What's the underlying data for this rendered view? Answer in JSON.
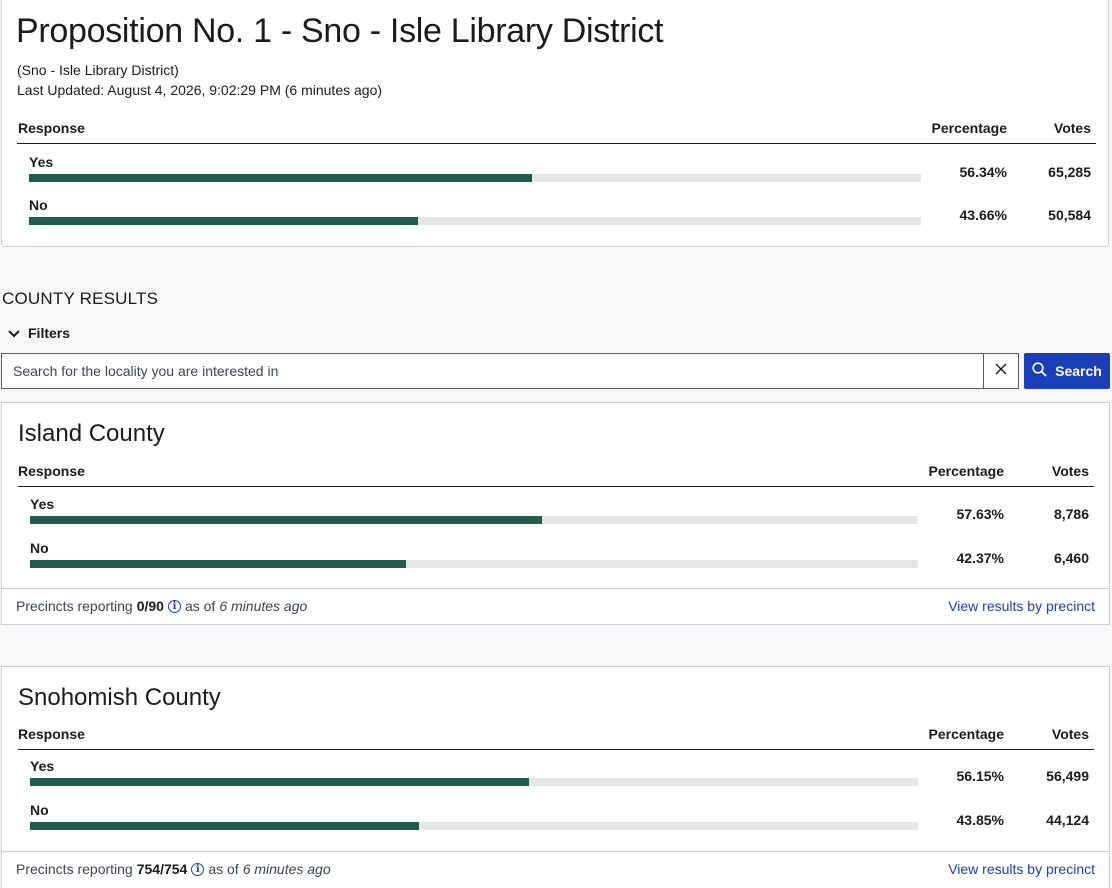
{
  "summary": {
    "title": "Proposition No. 1 - Sno - Isle Library District",
    "district": "(Sno - Isle Library District)",
    "last_updated": "Last Updated: August 4, 2026, 9:02:29 PM (6 minutes ago)",
    "headers": {
      "response": "Response",
      "percentage": "Percentage",
      "votes": "Votes"
    },
    "rows": [
      {
        "label": "Yes",
        "percentage": "56.34%",
        "votes": "65,285",
        "fraction": 0.5634
      },
      {
        "label": "No",
        "percentage": "43.66%",
        "votes": "50,584",
        "fraction": 0.4366
      }
    ]
  },
  "county_results": {
    "title": "COUNTY RESULTS",
    "filters_label": "Filters"
  },
  "search": {
    "placeholder": "Search for the locality you are interested in",
    "button_label": "Search"
  },
  "counties": [
    {
      "name": "Island County",
      "headers": {
        "response": "Response",
        "percentage": "Percentage",
        "votes": "Votes"
      },
      "rows": [
        {
          "label": "Yes",
          "percentage": "57.63%",
          "votes": "8,786",
          "fraction": 0.5763
        },
        {
          "label": "No",
          "percentage": "42.37%",
          "votes": "6,460",
          "fraction": 0.4237
        }
      ],
      "precincts_label": "Precincts reporting",
      "precincts_value": "0/90",
      "as_of_label": "as of",
      "as_of_value": "6 minutes ago",
      "view_link": "View results by precinct"
    },
    {
      "name": "Snohomish County",
      "headers": {
        "response": "Response",
        "percentage": "Percentage",
        "votes": "Votes"
      },
      "rows": [
        {
          "label": "Yes",
          "percentage": "56.15%",
          "votes": "56,499",
          "fraction": 0.5615
        },
        {
          "label": "No",
          "percentage": "43.85%",
          "votes": "44,124",
          "fraction": 0.4385
        }
      ],
      "precincts_label": "Precincts reporting",
      "precincts_value": "754/754",
      "as_of_label": "as of",
      "as_of_value": "6 minutes ago",
      "view_link": "View results by precinct"
    }
  ],
  "colors": {
    "bar_fill": "#1f5c4b",
    "bar_track": "#e6e6e6",
    "accent": "#1a3fb9"
  }
}
